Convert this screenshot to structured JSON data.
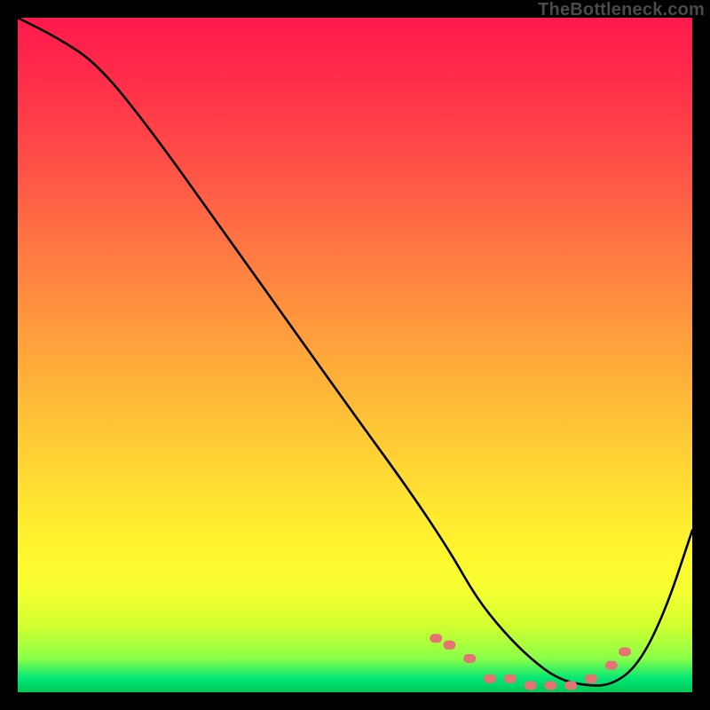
{
  "attribution": "TheBottleneck.com",
  "chart_data": {
    "type": "line",
    "title": "",
    "xlabel": "",
    "ylabel": "",
    "xlim": [
      0,
      100
    ],
    "ylim": [
      0,
      100
    ],
    "grid": false,
    "legend": false,
    "background_gradient": {
      "direction": "vertical",
      "stops": [
        {
          "pos": 0.0,
          "color": "#ff1a4d"
        },
        {
          "pos": 0.3,
          "color": "#ff7a42"
        },
        {
          "pos": 0.6,
          "color": "#ffc636"
        },
        {
          "pos": 0.8,
          "color": "#fff82d"
        },
        {
          "pos": 0.93,
          "color": "#8aff48"
        },
        {
          "pos": 1.0,
          "color": "#00c853"
        }
      ]
    },
    "series": [
      {
        "name": "bottleneck-curve",
        "color": "#000000",
        "x": [
          0,
          6,
          12,
          20,
          30,
          40,
          50,
          58,
          64,
          68,
          72,
          76,
          80,
          84,
          88,
          92,
          96,
          100
        ],
        "y": [
          100,
          97,
          93,
          83,
          69,
          55,
          41,
          30,
          21,
          14,
          9,
          5,
          2,
          1,
          1,
          4,
          12,
          24
        ]
      }
    ],
    "markers": {
      "name": "highlight-dots",
      "color": "#e57373",
      "shape": "rounded",
      "points": [
        {
          "x": 62,
          "y": 8
        },
        {
          "x": 64,
          "y": 7
        },
        {
          "x": 67,
          "y": 5
        },
        {
          "x": 70,
          "y": 2
        },
        {
          "x": 73,
          "y": 2
        },
        {
          "x": 76,
          "y": 1
        },
        {
          "x": 79,
          "y": 1
        },
        {
          "x": 82,
          "y": 1
        },
        {
          "x": 85,
          "y": 2
        },
        {
          "x": 88,
          "y": 4
        },
        {
          "x": 90,
          "y": 6
        }
      ]
    }
  }
}
